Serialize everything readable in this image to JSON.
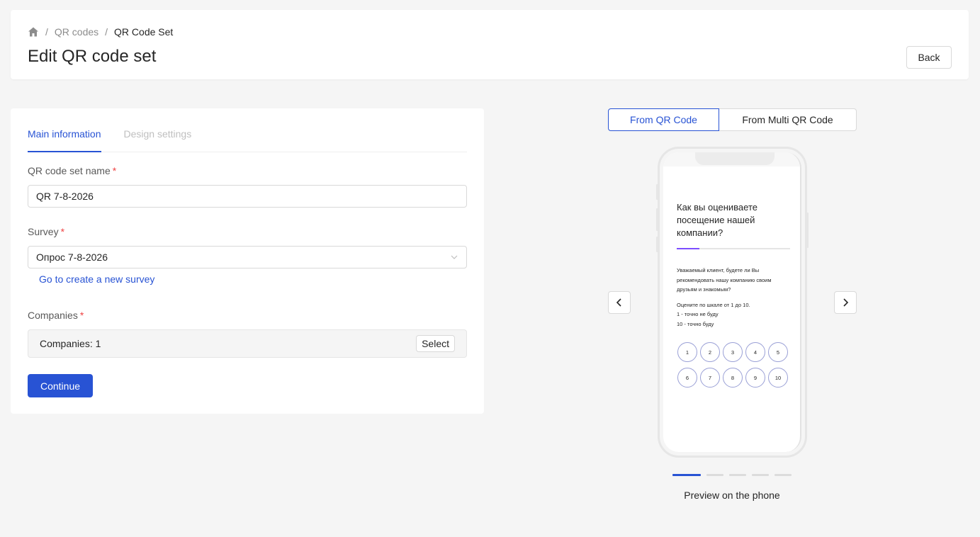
{
  "breadcrumb": {
    "home_icon": "home-icon",
    "sep": "/",
    "items": [
      "QR codes",
      "QR Code Set"
    ]
  },
  "header": {
    "title": "Edit QR code set",
    "back_label": "Back"
  },
  "form": {
    "tabs": [
      {
        "label": "Main information",
        "active": true
      },
      {
        "label": "Design settings",
        "active": false
      }
    ],
    "name_label": "QR code set name",
    "name_value": "QR 7-8-2026",
    "survey_label": "Survey",
    "survey_value": "Опрос 7-8-2026",
    "create_survey_link": "Go to create a new survey",
    "companies_label": "Companies",
    "companies_value": "Companies: 1",
    "select_label": "Select",
    "continue_label": "Continue",
    "required_mark": "*"
  },
  "preview": {
    "toggle": {
      "active": "From QR Code",
      "inactive": "From Multi QR Code"
    },
    "question_title": "Как вы оцениваете посещение нашей компании?",
    "progress": 0.2,
    "question_text": "Уважаемый клиент, будете ли Вы рекомендовать нашу компанию своим друзьям и знакомым?",
    "scale_hint": "Оцените по шкале от 1 до 10.",
    "scale_min_label": "1 - точно не буду",
    "scale_max_label": "10 - точно буду",
    "scale_row1": [
      "1",
      "2",
      "3",
      "4",
      "5"
    ],
    "scale_row2": [
      "6",
      "7",
      "8",
      "9",
      "10"
    ],
    "slides_total": 5,
    "slide_active": 1,
    "label": "Preview on the phone"
  },
  "colors": {
    "accent": "#2853d4",
    "progress": "#7c4dff",
    "required": "#ef4444"
  }
}
